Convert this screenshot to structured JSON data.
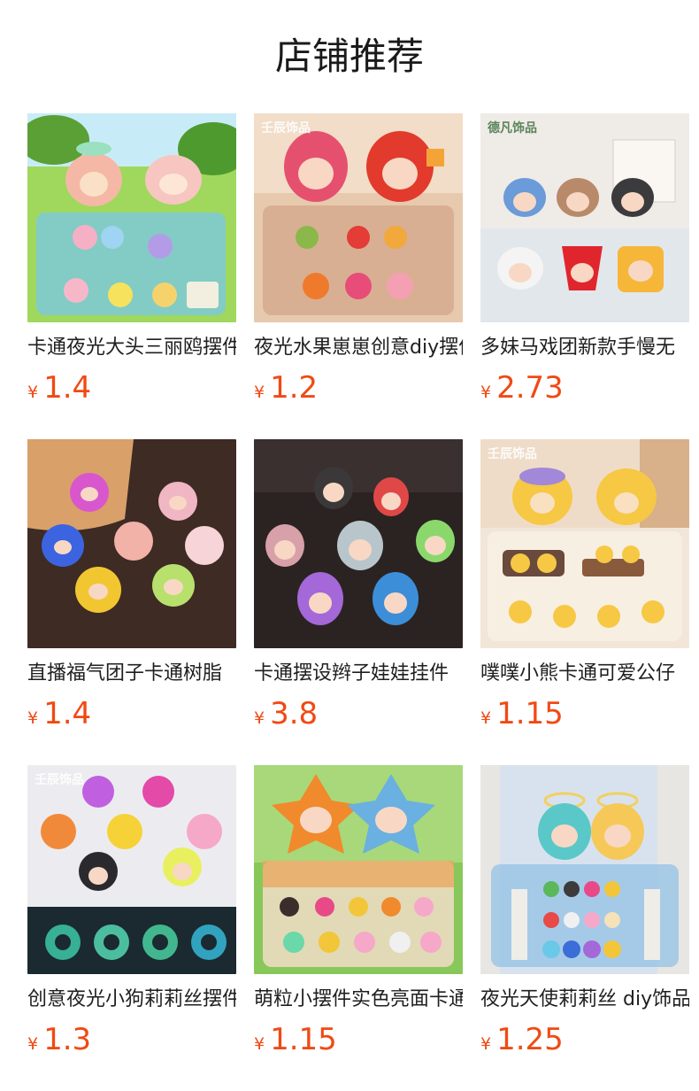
{
  "page": {
    "title": "店铺推荐"
  },
  "products": [
    {
      "title": "卡通夜光大头三丽鸥摆件",
      "currency": "¥",
      "price": "1.4",
      "image_icon": "product-photo-figurines-garden",
      "bg": "#8fd14f"
    },
    {
      "title": "夜光水果崽崽创意diy摆件",
      "currency": "¥",
      "price": "1.2",
      "image_icon": "product-photo-fruit-figurines",
      "bg": "#d8b79a",
      "watermark": "壬辰饰品"
    },
    {
      "title": "多妹马戏团新款手慢无",
      "currency": "¥",
      "price": "2.73",
      "image_icon": "product-photo-circus-figurines",
      "bg": "#e6e0db",
      "watermark": "德凡饰品"
    },
    {
      "title": "直播福气团子卡通树脂",
      "currency": "¥",
      "price": "1.4",
      "image_icon": "product-photo-sheep-figurines",
      "bg": "#3a2a24"
    },
    {
      "title": "卡通摆设辫子娃娃挂件",
      "currency": "¥",
      "price": "3.8",
      "image_icon": "product-photo-braid-doll-figurines",
      "bg": "#2c2422"
    },
    {
      "title": "噗噗小熊卡通可爱公仔",
      "currency": "¥",
      "price": "1.15",
      "image_icon": "product-photo-bear-figurines",
      "bg": "#e9d7c4",
      "watermark": "壬辰饰品"
    },
    {
      "title": "创意夜光小狗莉莉丝摆件",
      "currency": "¥",
      "price": "1.3",
      "image_icon": "product-photo-dog-figurines-glow",
      "bg": "#e9e9ec",
      "watermark": "壬辰饰品"
    },
    {
      "title": "萌粒小摆件实色亮面卡通",
      "currency": "¥",
      "price": "1.15",
      "image_icon": "product-photo-star-figurines",
      "bg": "#7cbf4e"
    },
    {
      "title": "夜光天使莉莉丝 diy饰品",
      "currency": "¥",
      "price": "1.25",
      "image_icon": "product-photo-angel-figurines",
      "bg": "#cfd9e6"
    }
  ]
}
